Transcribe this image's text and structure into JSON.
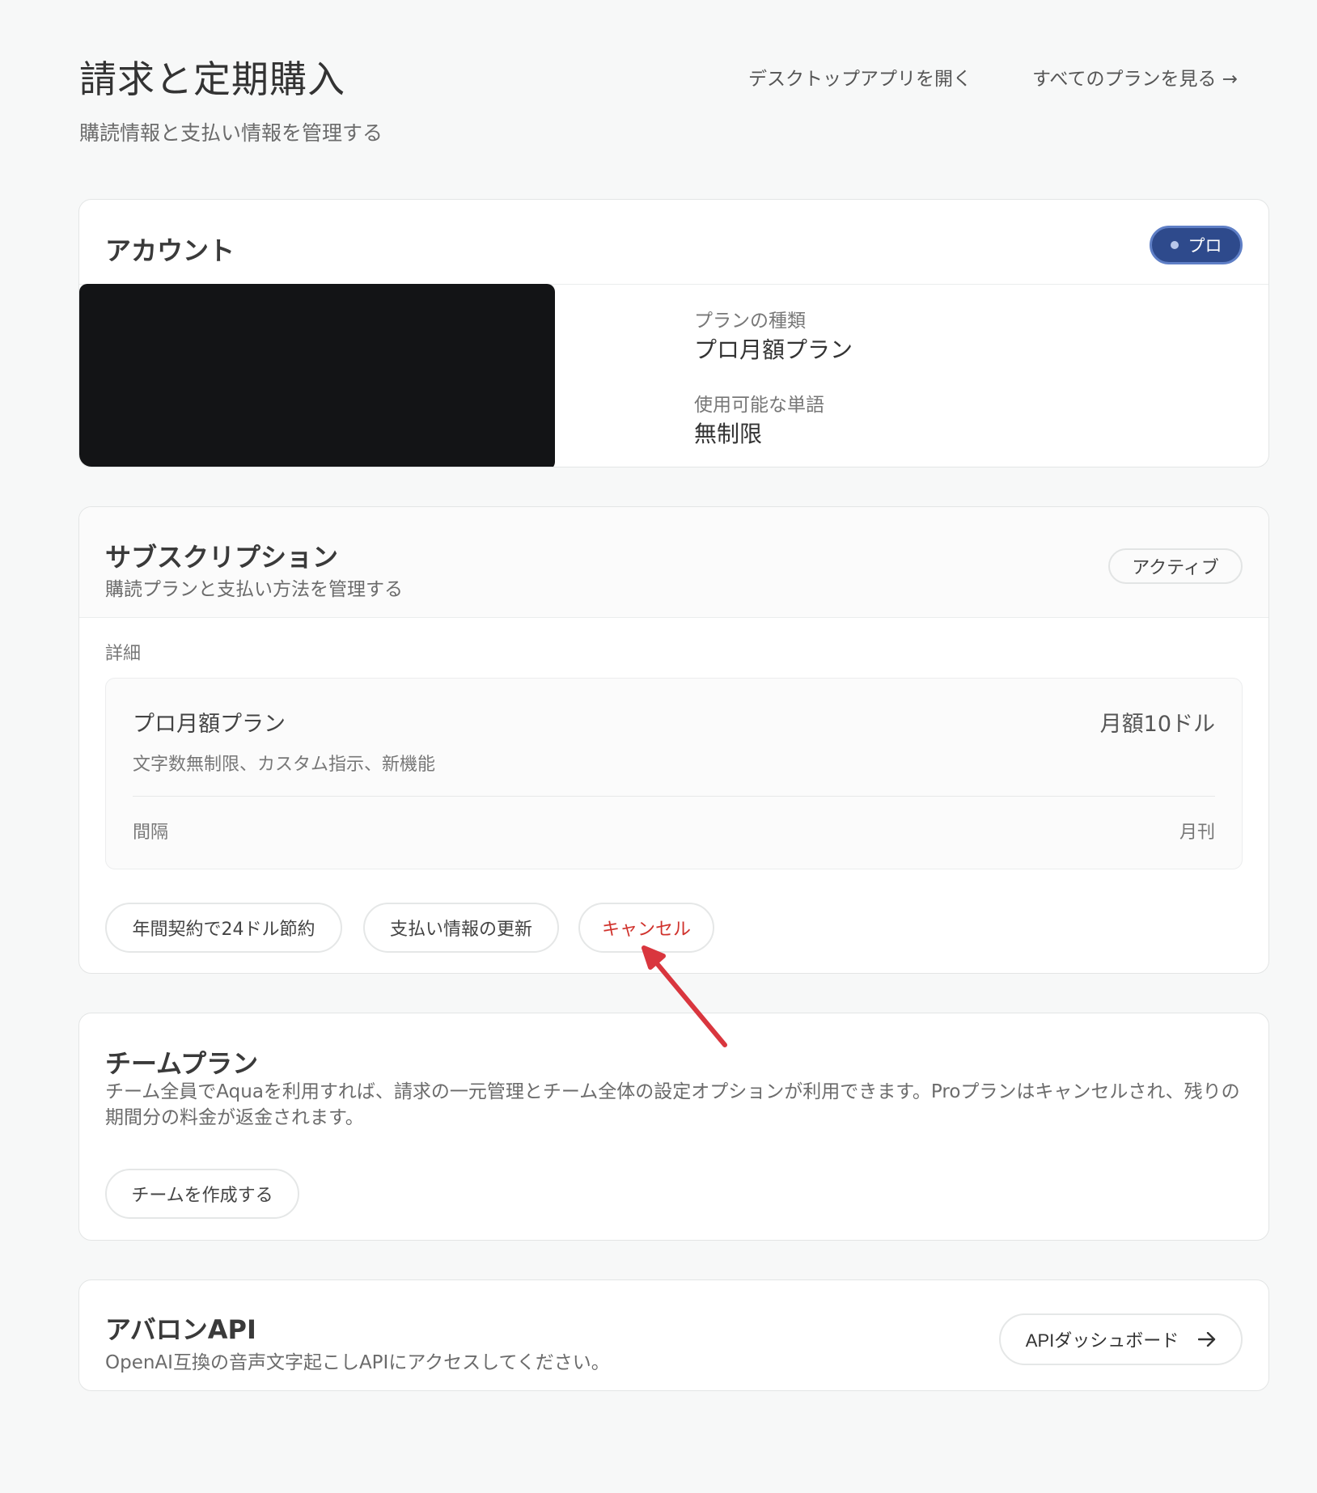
{
  "header": {
    "title": "請求と定期購入",
    "subtitle": "購読情報と支払い情報を管理する",
    "open_desktop_link": "デスクトップアプリを開く",
    "all_plans_link": "すべてのプランを見る →"
  },
  "account": {
    "title": "アカウント",
    "badge": "プロ",
    "plan_type_label": "プランの種類",
    "plan_type_value": "プロ月額プラン",
    "words_label": "使用可能な単語",
    "words_value": "無制限"
  },
  "subscription": {
    "title": "サブスクリプション",
    "description": "購読プランと支払い方法を管理する",
    "status_badge": "アクティブ",
    "details_label": "詳細",
    "plan_name": "プロ月額プラン",
    "plan_price": "月額10ドル",
    "plan_features": "文字数無制限、カスタム指示、新機能",
    "interval_label": "間隔",
    "interval_value": "月刊",
    "annual_button": "年間契約で24ドル節約",
    "update_payment_button": "支払い情報の更新",
    "cancel_button": "キャンセル"
  },
  "team": {
    "title": "チームプラン",
    "description": "チーム全員でAquaを利用すれば、請求の一元管理とチーム全体の設定オプションが利用できます。Proプランはキャンセルされ、残りの期間分の料金が返金されます。",
    "create_button": "チームを作成する"
  },
  "api": {
    "title": "アバロンAPI",
    "description": "OpenAI互換の音声文字起こしAPIにアクセスしてください。",
    "dashboard_button": "APIダッシュボード"
  },
  "colors": {
    "pro_badge": "#2e4a8c",
    "cancel_text": "#d0322c",
    "annotation_arrow": "#d9363e"
  }
}
